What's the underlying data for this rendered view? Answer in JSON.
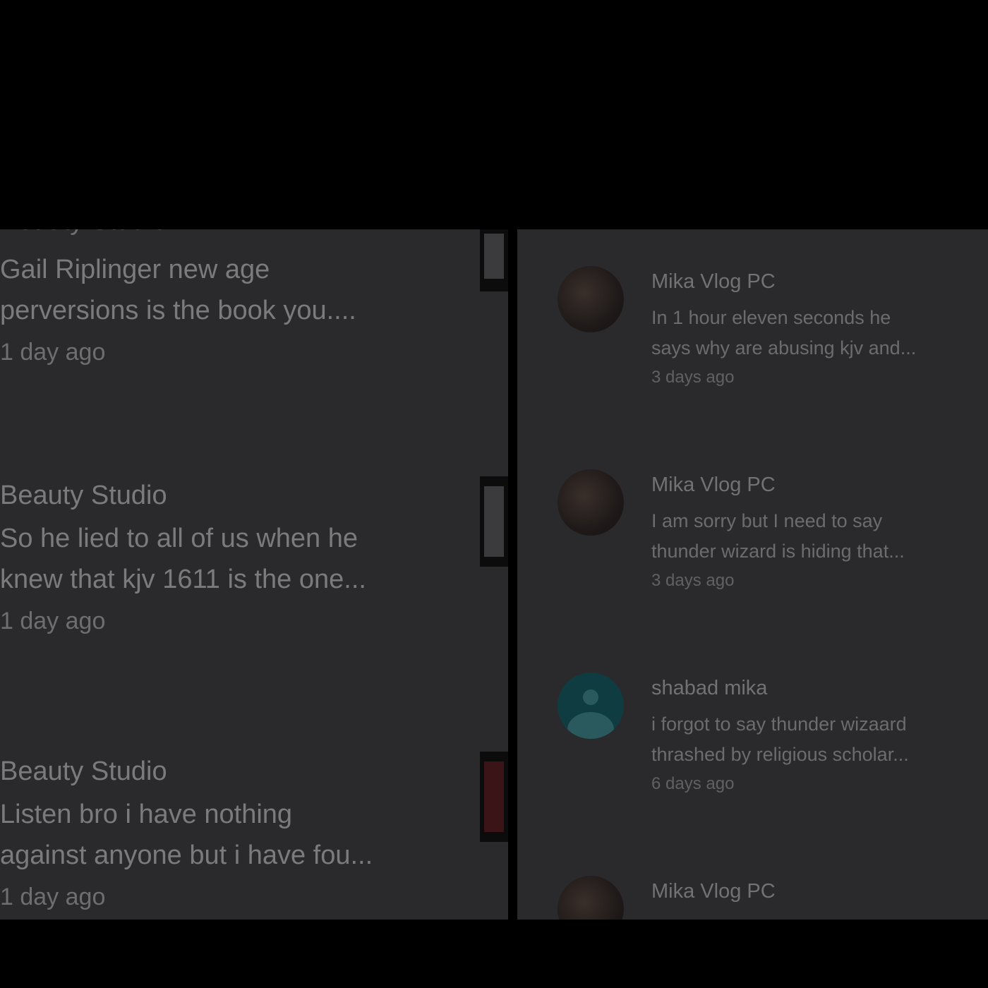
{
  "left_panel": {
    "cut_author": "Beauty Studio",
    "comments": [
      {
        "author": "",
        "lines": [
          "Gail Riplinger new age",
          "perversions is the book you...."
        ],
        "time": "1 day ago"
      },
      {
        "author": "Beauty Studio",
        "lines": [
          "So he lied to all of us when he",
          "knew that kjv 1611 is the one..."
        ],
        "time": "1 day ago"
      },
      {
        "author": "Beauty Studio",
        "lines": [
          "Listen bro i have nothing",
          "against anyone but i have fou..."
        ],
        "time": "1 day ago"
      }
    ]
  },
  "right_panel": {
    "comments": [
      {
        "author": "Mika Vlog PC",
        "lines": [
          "In 1 hour eleven seconds he",
          "says why are abusing kjv and..."
        ],
        "time": "3 days ago",
        "avatar": "photo-avatar"
      },
      {
        "author": "Mika Vlog PC",
        "lines": [
          "I am sorry but I need to say",
          "thunder wizard is hiding that..."
        ],
        "time": "3 days ago",
        "avatar": "photo-avatar"
      },
      {
        "author": "shabad mika",
        "lines": [
          "i forgot to say thunder wizaard",
          "thrashed by religious scholar..."
        ],
        "time": "6 days ago",
        "avatar": "default-person-avatar"
      },
      {
        "author": "Mika Vlog PC",
        "lines": [],
        "time": "",
        "avatar": "photo-avatar"
      }
    ]
  }
}
